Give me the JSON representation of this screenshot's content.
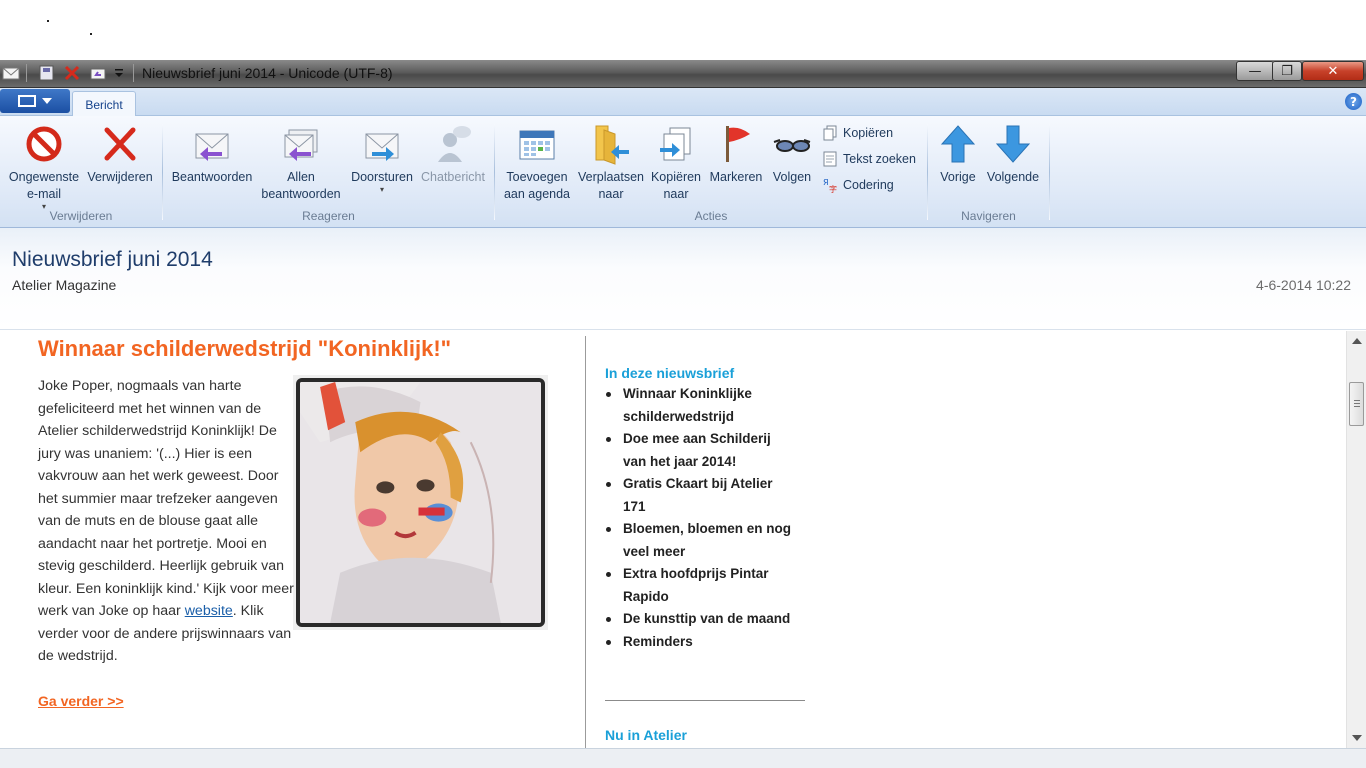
{
  "window": {
    "title": "Nieuwsbrief juni 2014 - Unicode (UTF-8)",
    "minimize_symbol": "—",
    "restore_symbol": "❐",
    "close_symbol": "✕"
  },
  "tabs": {
    "active": "Bericht",
    "help_symbol": "?"
  },
  "ribbon": {
    "groups": {
      "verwijderen": "Verwijderen",
      "reageren": "Reageren",
      "acties": "Acties",
      "navigeren": "Navigeren"
    },
    "buttons": {
      "junk_line1": "Ongewenste",
      "junk_line2": "e-mail",
      "delete": "Verwijderen",
      "reply": "Beantwoorden",
      "reply_all_line1": "Allen",
      "reply_all_line2": "beantwoorden",
      "forward": "Doorsturen",
      "chat": "Chatbericht",
      "calendar_line1": "Toevoegen",
      "calendar_line2": "aan agenda",
      "move_line1": "Verplaatsen",
      "move_line2": "naar",
      "copy_to_line1": "Kopiëren",
      "copy_to_line2": "naar",
      "flag": "Markeren",
      "watch": "Volgen",
      "copy": "Kopiëren",
      "find_text": "Tekst zoeken",
      "encoding": "Codering",
      "previous": "Vorige",
      "next": "Volgende"
    }
  },
  "header": {
    "subject": "Nieuwsbrief juni 2014",
    "sender": "Atelier Magazine",
    "date": "4-6-2014 10:22"
  },
  "article": {
    "title": "Winnaar schilderwedstrijd \"Koninklijk!\"",
    "text_before_link": "Joke Poper, nogmaals van harte gefeliciteerd met het winnen van de Atelier schilderwedstrijd Koninklijk! De jury was unaniem: '(...) Hier is een vakvrouw aan het werk geweest. Door het summier maar trefzeker aangeven van de muts en de blouse gaat alle aandacht naar het portretje. Mooi en stevig geschilderd. Heerlijk gebruik van kleur. Een koninklijk kind.' Kijk voor meer werk van Joke op haar ",
    "link_text": "website",
    "text_after_link": ". Klik verder voor de andere prijswinnaars van de wedstrijd.",
    "more_link": "Ga verder >>"
  },
  "toc": {
    "title": "In deze nieuwsbrief",
    "items": [
      "Winnaar Koninklijke schilderwedstrijd",
      "Doe mee aan Schilderij van het jaar 2014!",
      "Gratis Ckaart bij Atelier 171",
      "Bloemen, bloemen en nog veel meer",
      "Extra hoofdprijs Pintar Rapido",
      "De kunsttip van de maand",
      "Reminders"
    ],
    "next_section_title": "Nu in Atelier"
  }
}
